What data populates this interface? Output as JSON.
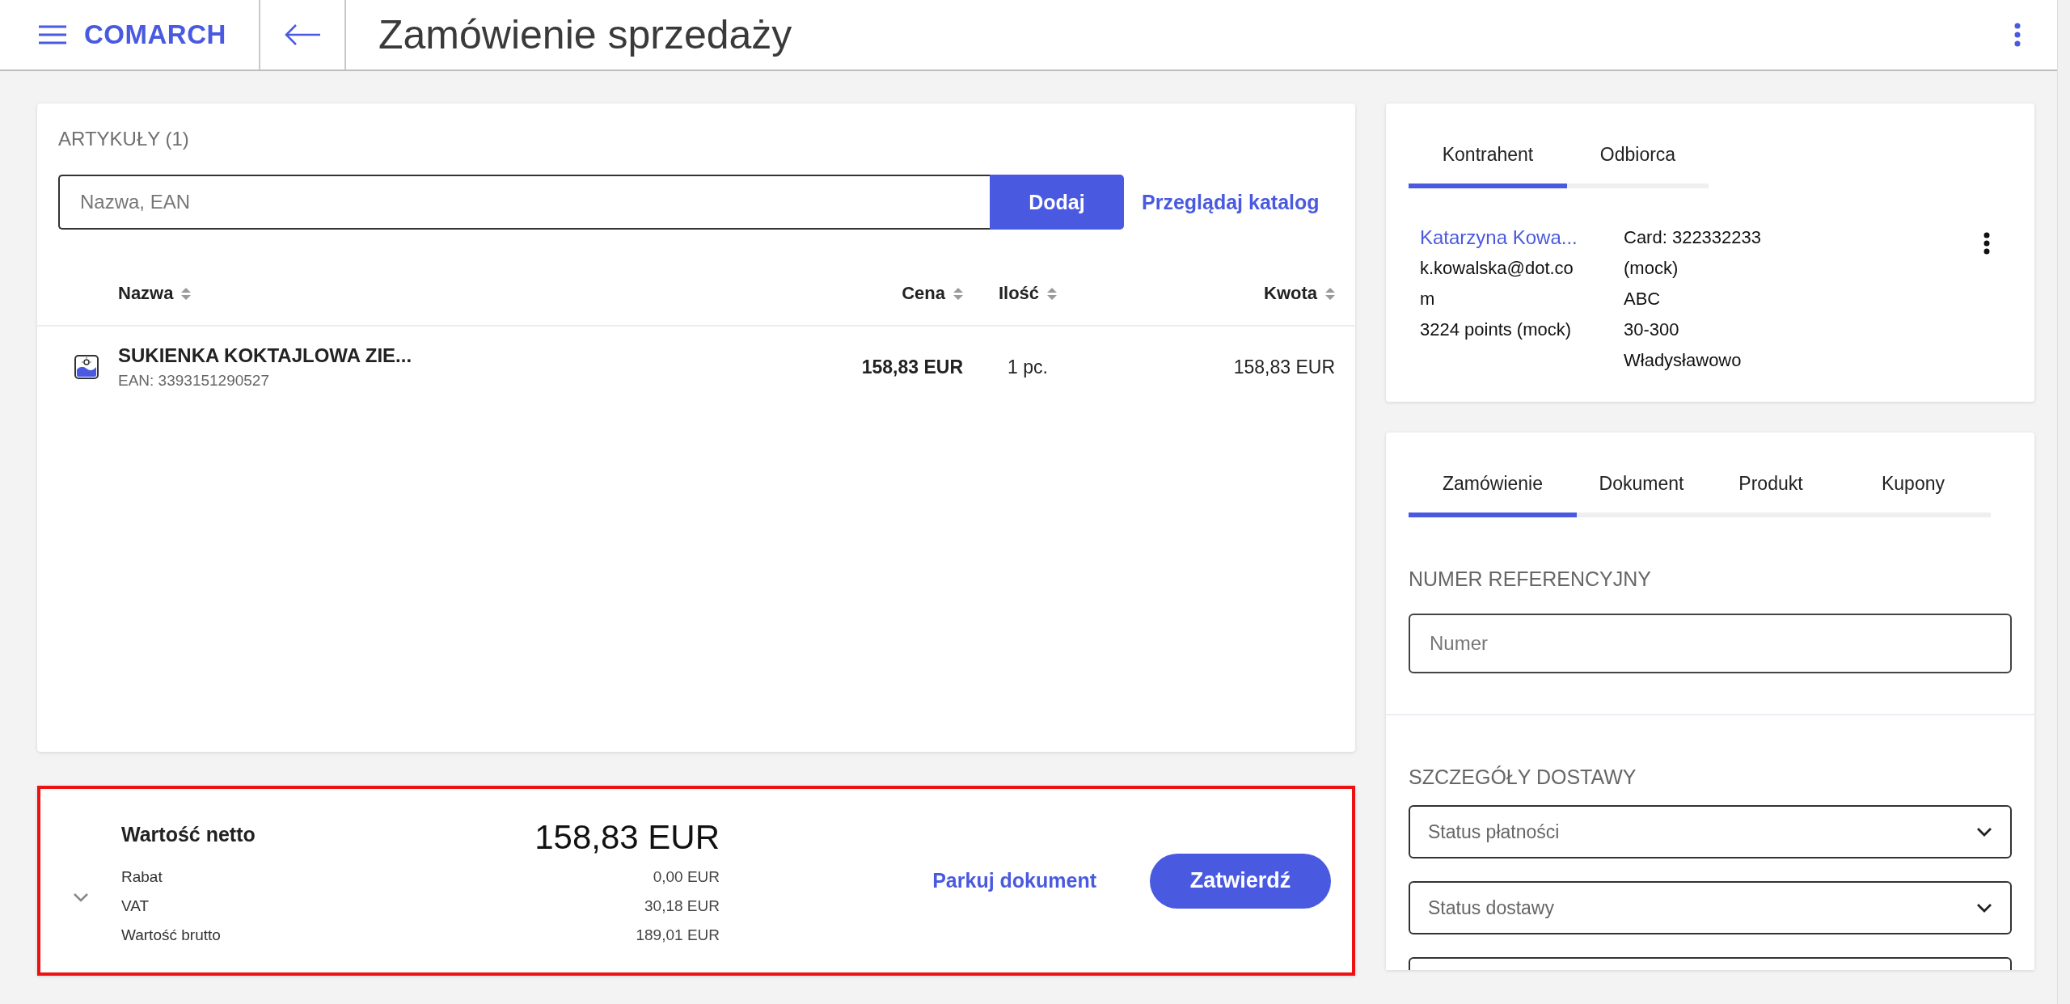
{
  "header": {
    "logo": "COMARCH",
    "title": "Zamówienie sprzedaży"
  },
  "articles": {
    "heading": "ARTYKUŁY (1)",
    "search": {
      "placeholder": "Nazwa, EAN"
    },
    "add_button": "Dodaj",
    "catalog_link": "Przeglądaj katalog",
    "columns": [
      {
        "label": "Nazwa"
      },
      {
        "label": "Cena"
      },
      {
        "label": "Ilość"
      },
      {
        "label": "Kwota"
      }
    ],
    "rows": [
      {
        "name": "SUKIENKA KOKTAJLOWA ZIE...",
        "ean": "EAN: 3393151290527",
        "price": "158,83 EUR",
        "quantity": "1 pc.",
        "amount": "158,83 EUR"
      }
    ]
  },
  "summary": {
    "highlighted": true,
    "expanded": false,
    "net_label": "Wartość netto",
    "net_value": "158,83 EUR",
    "lines": [
      {
        "label": "Rabat",
        "value": "0,00 EUR"
      },
      {
        "label": "VAT",
        "value": "30,18 EUR"
      },
      {
        "label": "Wartość brutto",
        "value": "189,01 EUR"
      }
    ],
    "park_link": "Parkuj dokument",
    "confirm_button": "Zatwierdź"
  },
  "customer": {
    "tabs": [
      {
        "label": "Kontrahent",
        "selected": true
      },
      {
        "label": "Odbiorca",
        "selected": false
      }
    ],
    "name": "Katarzyna Kowa...",
    "email": "k.kowalska@dot.com",
    "points": "3224 points (mock)",
    "card": "Card: 322332233 (mock)",
    "group": "ABC",
    "address": "30-300 Władysławowo"
  },
  "details": {
    "tabs": [
      {
        "label": "Zamówienie",
        "selected": true
      },
      {
        "label": "Dokument",
        "selected": false
      },
      {
        "label": "Produkt",
        "selected": false
      },
      {
        "label": "Kupony",
        "selected": false
      }
    ],
    "reference_heading": "NUMER REFERENCYJNY",
    "reference_field": {
      "placeholder": "Numer"
    },
    "delivery_heading": "SZCZEGÓŁY DOSTAWY",
    "dropdowns": [
      {
        "kind": "select",
        "placeholder": "Status płatności"
      },
      {
        "kind": "select",
        "placeholder": "Status dostawy"
      },
      {
        "kind": "cut_off"
      }
    ]
  }
}
